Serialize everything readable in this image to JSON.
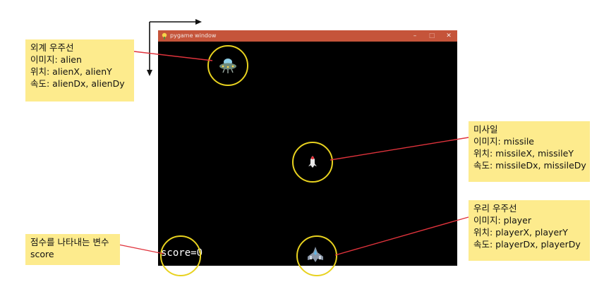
{
  "window": {
    "title": "pygame window",
    "minimize_glyph": "–",
    "maximize_glyph": "□",
    "close_glyph": "✕",
    "score_label": "score=0"
  },
  "callouts": {
    "alien": {
      "title": "외계 우주선",
      "image": "이미지: alien",
      "position": "위치: alienX, alienY",
      "speed": "속도: alienDx, alienDy"
    },
    "missile": {
      "title": "미사일",
      "image": "이미지: missile",
      "position": "위치: missileX, missileY",
      "speed": "속도: missileDx, missileDy"
    },
    "player": {
      "title": "우리 우주선",
      "image": "이미지: player",
      "position": "위치: playerX, playerY",
      "speed": "속도: playerDx, playerDy"
    },
    "score": {
      "title": "점수를 나타내는 변수",
      "name": "score"
    }
  },
  "colors": {
    "callout_bg": "#fdeb8d",
    "leader_line": "#e0333c",
    "highlight_circle": "#e8d21f",
    "titlebar": "#c5543a",
    "game_bg": "#000000"
  },
  "icons": [
    "pygame-app-icon",
    "alien-ufo-icon",
    "missile-icon",
    "player-ship-icon",
    "coordinate-axes-icon"
  ]
}
